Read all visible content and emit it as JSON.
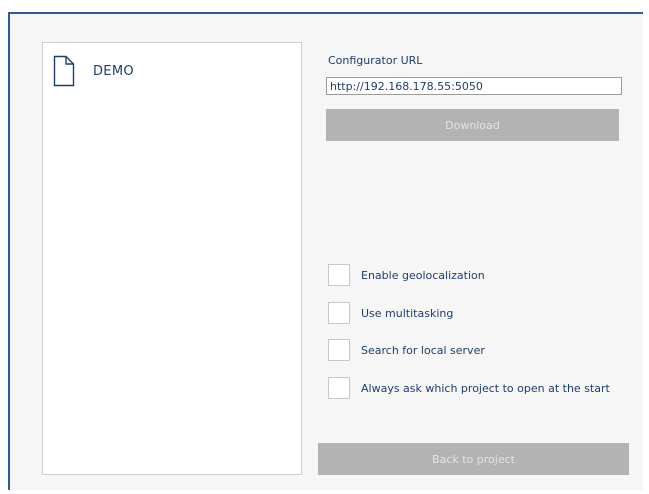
{
  "projects": [
    {
      "name": "DEMO",
      "icon": "document-icon"
    }
  ],
  "config": {
    "url_label": "Configurator URL",
    "url_value": "http://192.168.178.55:5050",
    "download_label": "Download"
  },
  "options": [
    {
      "label": "Enable geolocalization",
      "checked": false
    },
    {
      "label": "Use multitasking",
      "checked": false
    },
    {
      "label": "Search for local server",
      "checked": false
    },
    {
      "label": "Always ask which project to open at the start",
      "checked": false
    }
  ],
  "footer": {
    "back_label": "Back to project"
  },
  "colors": {
    "frame_border": "#2f5a96",
    "text": "#1d3f6e",
    "button_bg": "#b3b3b3",
    "button_text": "#e3e3e3"
  }
}
